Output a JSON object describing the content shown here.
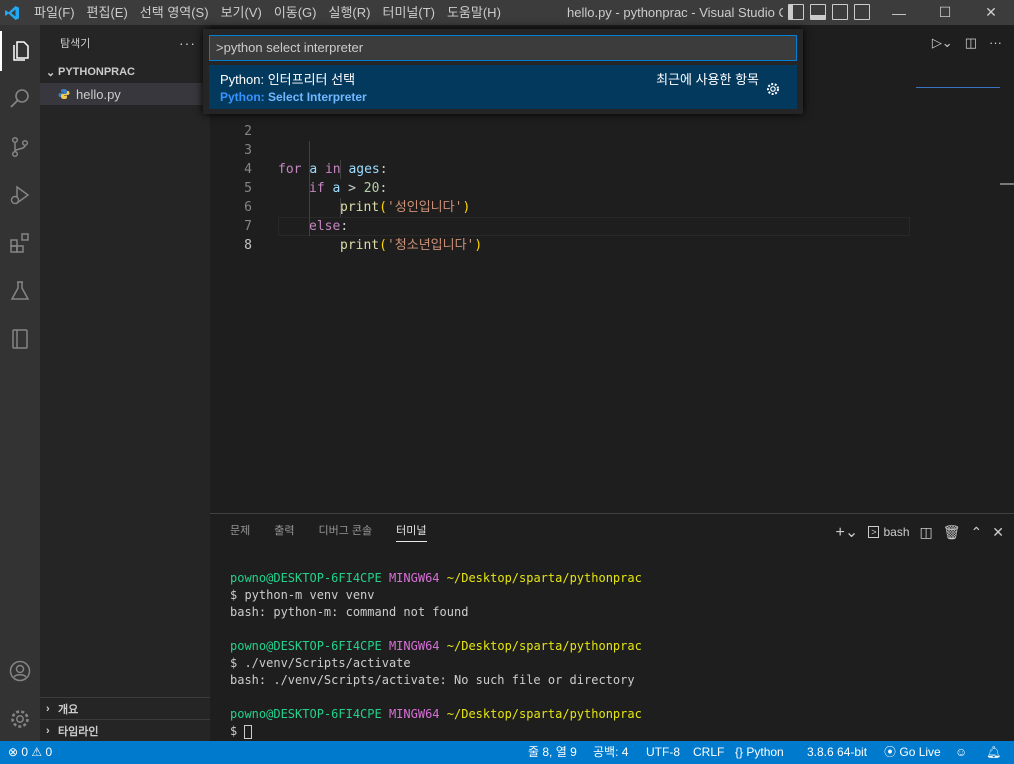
{
  "window": {
    "title": "hello.py - pythonprac - Visual Studio C...",
    "menu": [
      "파일(F)",
      "편집(E)",
      "선택 영역(S)",
      "보기(V)",
      "이동(G)",
      "실행(R)",
      "터미널(T)",
      "도움말(H)"
    ],
    "controls": {
      "minimize": "—",
      "maximize": "☐",
      "close": "✕"
    }
  },
  "sidebar": {
    "title": "탐색기",
    "more": "···",
    "folder": "PYTHONPRAC",
    "file": "hello.py",
    "outline": "개요",
    "timeline": "타임라인"
  },
  "editor": {
    "lines": [
      {
        "num": "2"
      },
      {
        "num": "3"
      },
      {
        "num": "4"
      },
      {
        "num": "5"
      },
      {
        "num": "6"
      },
      {
        "num": "7"
      },
      {
        "num": "8"
      }
    ],
    "code": {
      "l3_for": "for",
      "l3_a": "a",
      "l3_in": "in",
      "l3_ages": "ages",
      "l3_colon": ":",
      "l4_if": "if",
      "l4_a": "a",
      "l4_op": " > ",
      "l4_num": "20",
      "l4_colon": ":",
      "l5_print": "print",
      "l5_open": "(",
      "l5_str": "'성인입니다'",
      "l5_close": ")",
      "l6_else": "else",
      "l6_colon": ":",
      "l7_print": "print",
      "l7_open": "(",
      "l7_str": "'청소년입니다'",
      "l7_close": ")"
    }
  },
  "palette": {
    "input": ">python select interpreter",
    "item_title_prefix": "Python:",
    "item_title_rest": " 인터프리터 선택",
    "item_detail_prefix": "Python:",
    "item_detail_rest": " Select Interpreter",
    "recent": "최근에 사용한 항목"
  },
  "panel": {
    "tabs": [
      "문제",
      "출력",
      "디버그 콘솔",
      "터미널"
    ],
    "active_tab": 3,
    "terminal_label": "bash",
    "terminal": [
      {
        "user": "powno@DESKTOP-6FI4CPE",
        "env": "MINGW64",
        "path": "~/Desktop/sparta/pythonprac"
      },
      {
        "text": "$ python-m venv venv"
      },
      {
        "text": "bash: python-m: command not found"
      },
      {
        "user": "powno@DESKTOP-6FI4CPE",
        "env": "MINGW64",
        "path": "~/Desktop/sparta/pythonprac"
      },
      {
        "text": "$ ./venv/Scripts/activate"
      },
      {
        "text": "bash: ./venv/Scripts/activate: No such file or directory"
      },
      {
        "user": "powno@DESKTOP-6FI4CPE",
        "env": "MINGW64",
        "path": "~/Desktop/sparta/pythonprac"
      },
      {
        "text": "$ "
      }
    ]
  },
  "statusbar": {
    "errors": "0",
    "warnings": "0",
    "position": "줄 8, 열 9",
    "spaces": "공백: 4",
    "encoding": "UTF-8",
    "eol": "CRLF",
    "language": "Python",
    "interpreter": "3.8.6 64-bit",
    "golive": "Go Live"
  },
  "colors": {
    "accent": "#007acc",
    "selection": "#04395e",
    "keyword": "#c586c0",
    "string": "#ce9178"
  }
}
